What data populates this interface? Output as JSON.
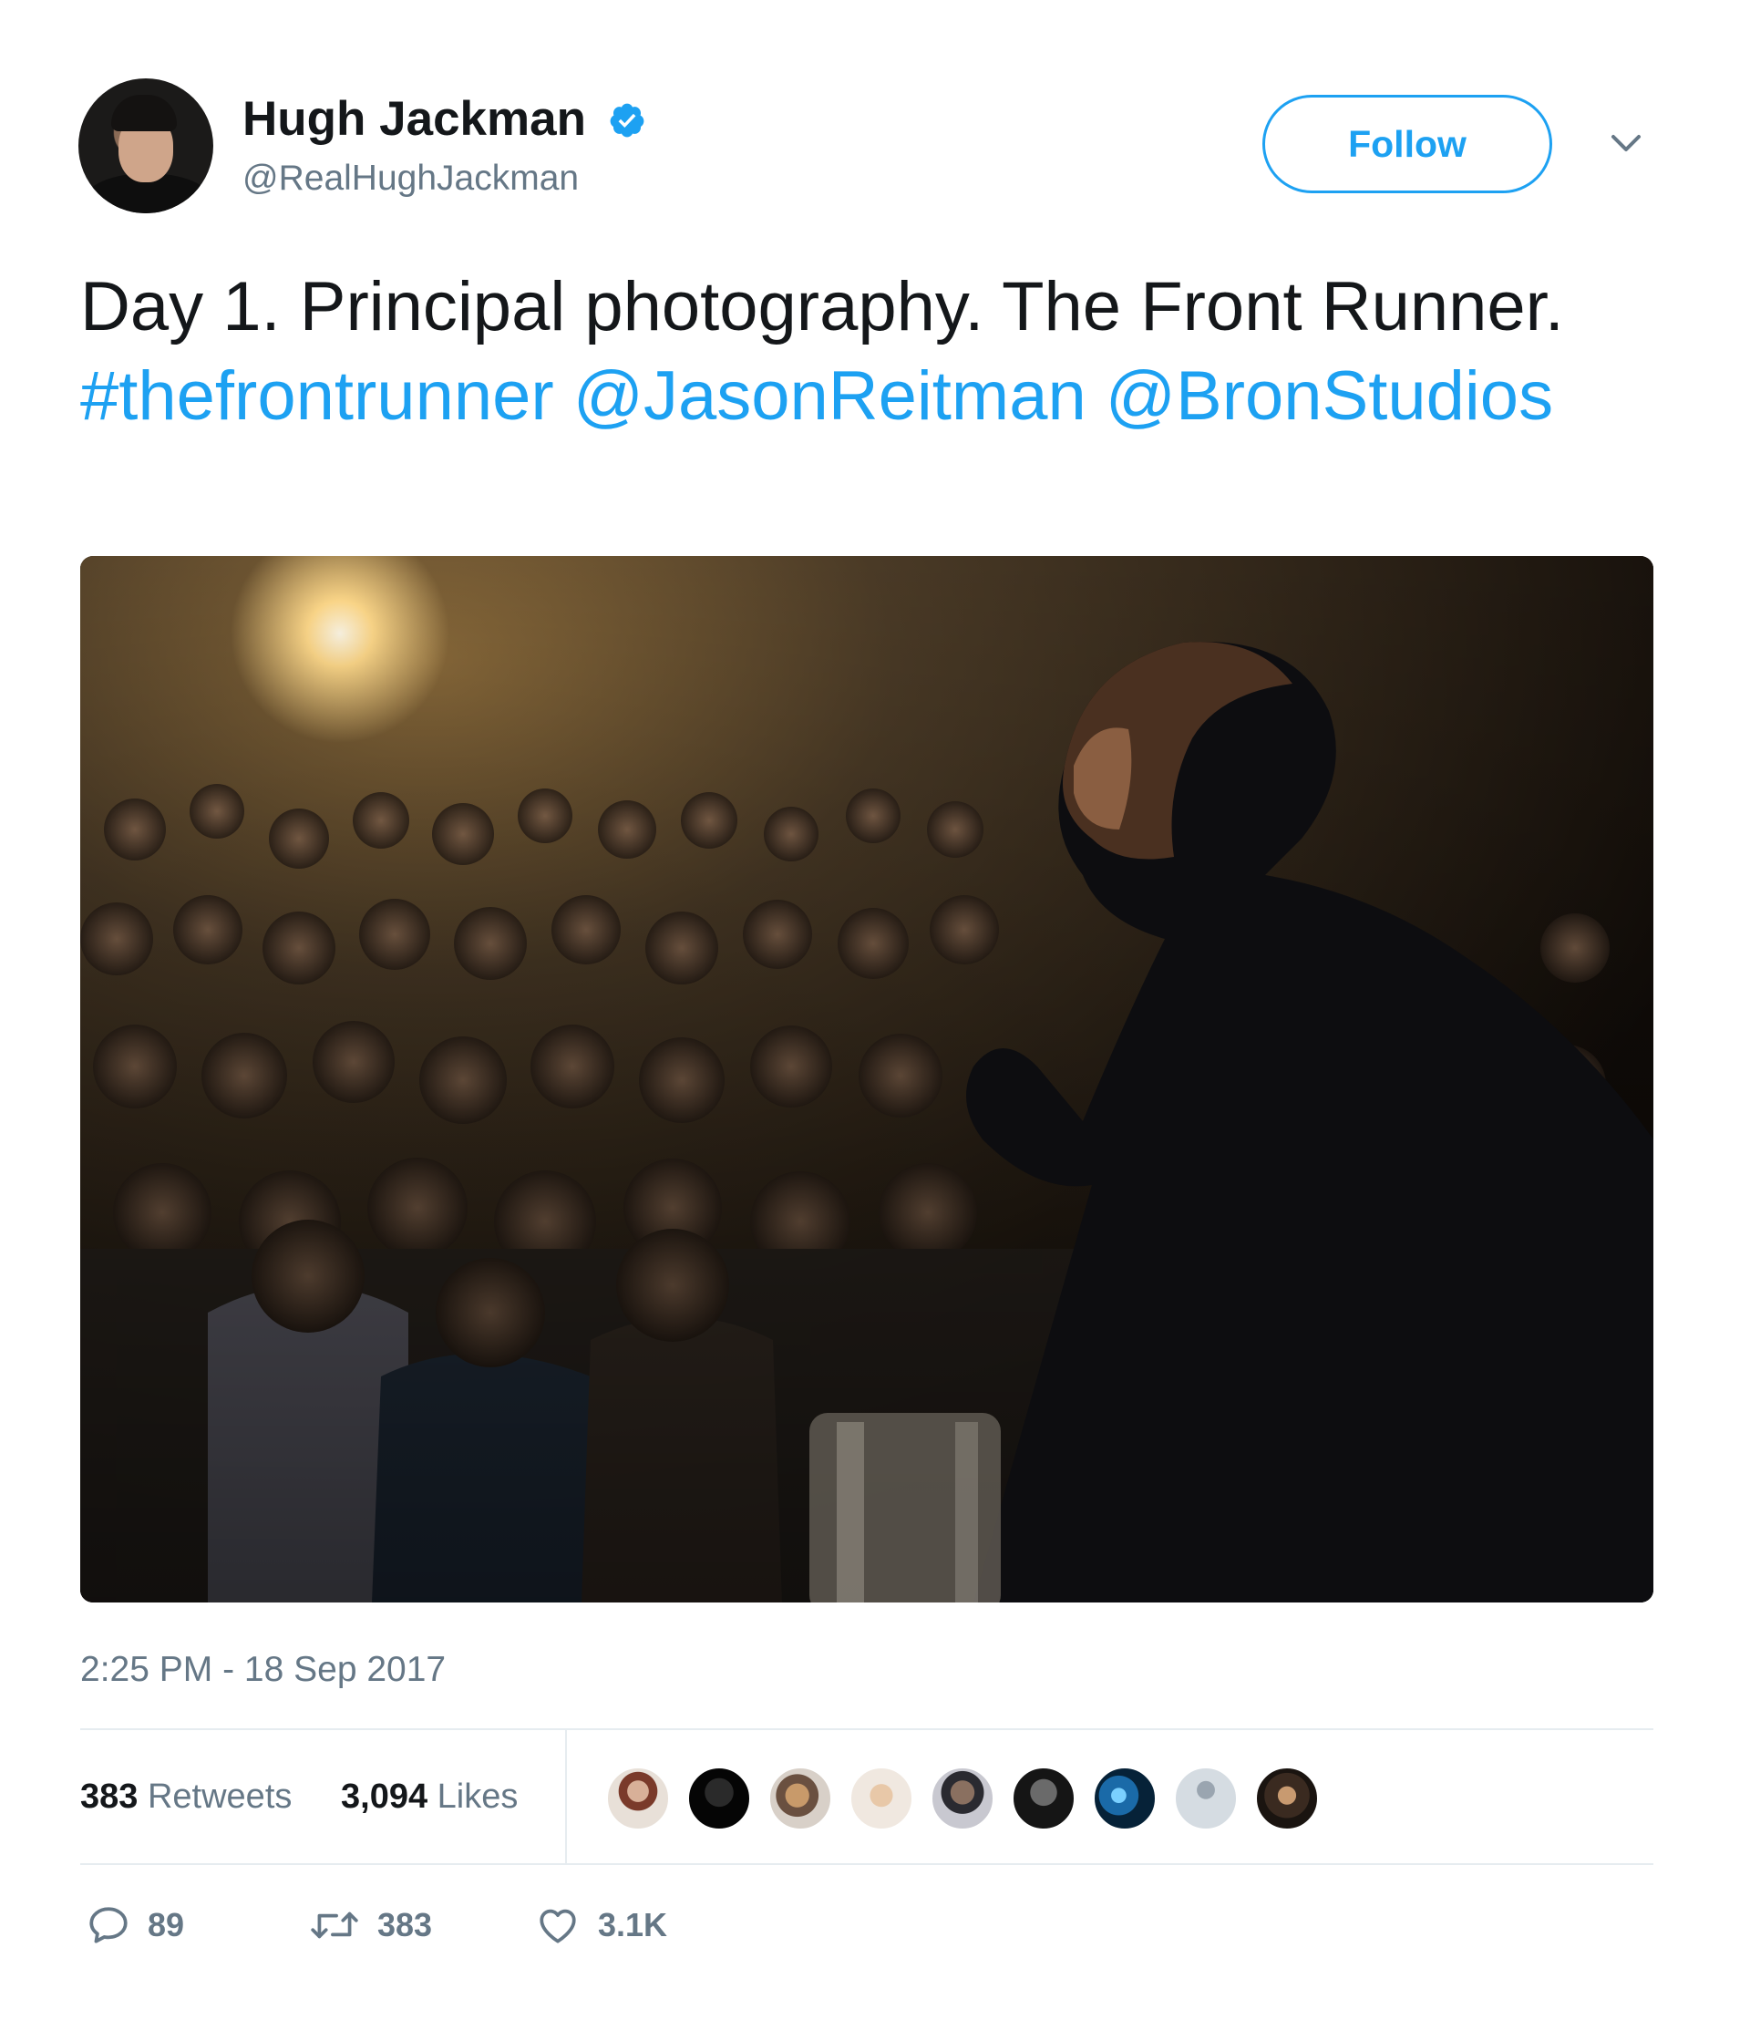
{
  "user": {
    "name": "Hugh Jackman",
    "handle": "@RealHughJackman",
    "verified_icon": "verified-badge-icon"
  },
  "header": {
    "follow_label": "Follow",
    "menu_icon": "chevron-down-icon"
  },
  "tweet": {
    "text_plain": "Day 1. Principal photography. The Front Runner.",
    "hashtag": "#thefrontrunner",
    "mention_1": "@JasonReitman",
    "mention_2": "@BronStudios",
    "timestamp": "2:25 PM - 18 Sep 2017"
  },
  "stats": {
    "retweets_count": "383",
    "retweets_label": "Retweets",
    "likes_count": "3,094",
    "likes_label": "Likes",
    "liker_avatar_count": 9
  },
  "actions": {
    "reply_count": "89",
    "retweet_count": "383",
    "like_count": "3.1K"
  },
  "colors": {
    "accent": "#1da1f2",
    "text": "#14171a",
    "muted": "#657786",
    "divider": "#e6ecf0"
  }
}
